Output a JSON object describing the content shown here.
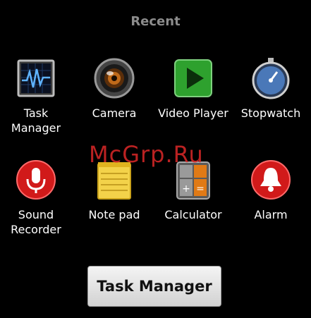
{
  "dialog": {
    "title": "Recent"
  },
  "apps": [
    {
      "label": "Task\nManager",
      "icon": "task-manager-icon"
    },
    {
      "label": "Camera",
      "icon": "camera-icon"
    },
    {
      "label": "Video Player",
      "icon": "video-player-icon"
    },
    {
      "label": "Stopwatch",
      "icon": "stopwatch-icon"
    },
    {
      "label": "Sound\nRecorder",
      "icon": "sound-recorder-icon"
    },
    {
      "label": "Note pad",
      "icon": "note-pad-icon"
    },
    {
      "label": "Calculator",
      "icon": "calculator-icon"
    },
    {
      "label": "Alarm",
      "icon": "alarm-icon"
    }
  ],
  "watermark": "McGrp.Ru",
  "footer": {
    "button_label": "Task Manager"
  },
  "colors": {
    "background": "#000000",
    "title": "#8c8c8c",
    "watermark": "#dc2828"
  }
}
